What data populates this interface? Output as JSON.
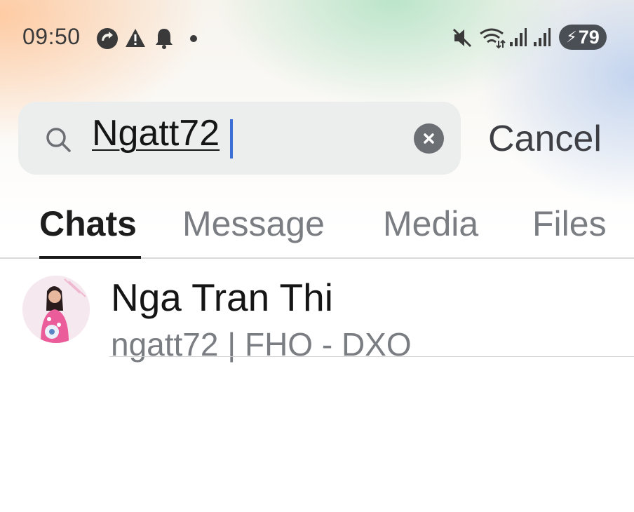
{
  "status_bar": {
    "time": "09:50",
    "battery_level": "79",
    "icons": [
      "sync-icon",
      "alert-icon",
      "bell-icon",
      "dot-icon",
      "mute-icon",
      "wifi-icon",
      "signal-icon",
      "signal-icon",
      "charging-bolt-icon"
    ]
  },
  "search": {
    "value": "Ngatt72",
    "cancel_label": "Cancel"
  },
  "tabs": [
    {
      "label": "Chats",
      "active": true
    },
    {
      "label": "Message",
      "active": false
    },
    {
      "label": "Media",
      "active": false
    },
    {
      "label": "Files",
      "active": false
    }
  ],
  "results": [
    {
      "name": "Nga Tran Thi",
      "subtitle": "ngatt72 | FHO - DXO"
    }
  ],
  "colors": {
    "caret": "#3b6fd6",
    "tab_active": "#1d1d1d",
    "tab_inactive": "#7a7d82"
  }
}
